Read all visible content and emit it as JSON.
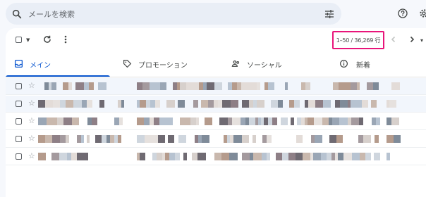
{
  "search": {
    "placeholder": "メールを検索",
    "value": ""
  },
  "icons": {
    "search": "search-icon",
    "tune": "tune-icon",
    "help": "help-icon",
    "settings": "gear-icon",
    "select_all": "checkbox-icon",
    "refresh": "refresh-icon",
    "more": "more-vert-icon",
    "prev": "chevron-left-icon",
    "next": "chevron-right-icon"
  },
  "toolbar": {
    "pagination": "1–50 / 36,269 行"
  },
  "tabs": [
    {
      "label": "メイン",
      "icon": "inbox-icon",
      "active": true
    },
    {
      "label": "プロモーション",
      "icon": "tag-icon",
      "active": false
    },
    {
      "label": "ソーシャル",
      "icon": "people-icon",
      "active": false
    },
    {
      "label": "新着",
      "icon": "info-icon",
      "active": false
    }
  ],
  "colors": {
    "accent": "#0b57d0",
    "highlight_box": "#e8157a",
    "search_bg": "#e9eef6",
    "page_bg": "#f6f8fc"
  },
  "rows": [
    {
      "read": true
    },
    {
      "read": true
    },
    {
      "read": false
    },
    {
      "read": false
    },
    {
      "read": false
    }
  ]
}
